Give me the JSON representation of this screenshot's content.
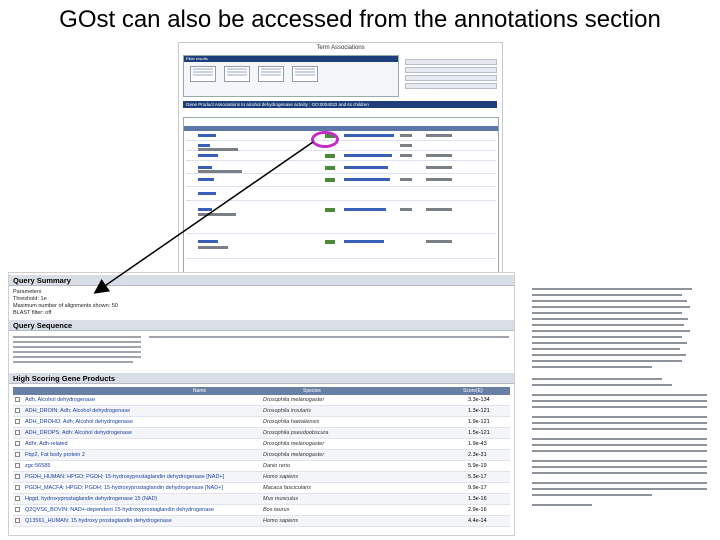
{
  "slide": {
    "title": "GOst can also be accessed from the annotations section"
  },
  "query_summary": {
    "heading": "Query Summary",
    "lines": [
      "Parameters",
      "Threshold: 1e",
      "Maximum number of alignments shown: 50",
      "BLAST filter: off"
    ]
  },
  "query_sequence": {
    "heading": "Query Sequence"
  },
  "products": {
    "heading": "High Scoring Gene Products",
    "columns": [
      "Name",
      "Species",
      "Score(E)"
    ],
    "rows": [
      {
        "name": "Adh, Alcohol dehydrogenase",
        "species": "Drosophila melanogaster",
        "score": "3.3e-134"
      },
      {
        "name": "ADH_DROIN: Adh; Alcohol dehydrogenase",
        "species": "Drosophila insularis",
        "score": "1.3e-121"
      },
      {
        "name": "ADH_DROHO: Adh; Alcohol dehydrogenase",
        "species": "Drosophila hawaiiensis",
        "score": "1.9e-121"
      },
      {
        "name": "ADH_DROPS: Adh: Alcohol dehydrogenase",
        "species": "Drosophila pseudoobscura",
        "score": "1.5e-121"
      },
      {
        "name": "Adhr, Adh-related",
        "species": "Drosophila melanogaster",
        "score": "1.9e-43"
      },
      {
        "name": "Fbp2, Fat body protein 2",
        "species": "Drosophila melanogaster",
        "score": "2.3e-31"
      },
      {
        "name": "zgc:56585",
        "species": "Danio rerio",
        "score": "5.9e-19"
      },
      {
        "name": "PGDH_HUMAN: HPGD; PGDH; 15-hydroxyprostaglandin dehydrogenase [NAD+]",
        "species": "Homo sapiens",
        "score": "5.3e-17"
      },
      {
        "name": "PGDH_MACFA: HPGD; PGDH; 15-hydroxyprostaglandin dehydrogenase [NAD+]",
        "species": "Macaca fascicularis",
        "score": "9.9e-17"
      },
      {
        "name": "Hpgd, hydroxyprostaglandin dehydrogenase 15 (NAD)",
        "species": "Mus musculus",
        "score": "1.3e-16"
      },
      {
        "name": "Q2QVS6_BOVIN: NAD+-dependent 15-hydroxyprostaglandin dehydrogenase",
        "species": "Bos taurus",
        "score": "2.9e-16"
      },
      {
        "name": "Q13561_HUMAN: 15 hydroxy prostaglandin dehydrogenase",
        "species": "Homo sapiens",
        "score": "4.4e-14"
      }
    ]
  },
  "term_associations": {
    "title": "Term Associations",
    "filter_header": "Filter results",
    "gene_product_header": "Gene Product Associations to alcohol dehydrogenase activity ; GO:0004022 and its children",
    "highlight": "BLAST"
  },
  "colors": {
    "highlight_circle": "#c62bc6",
    "header_blue": "#1f3f7a",
    "link_blue": "#1a3f9e"
  }
}
